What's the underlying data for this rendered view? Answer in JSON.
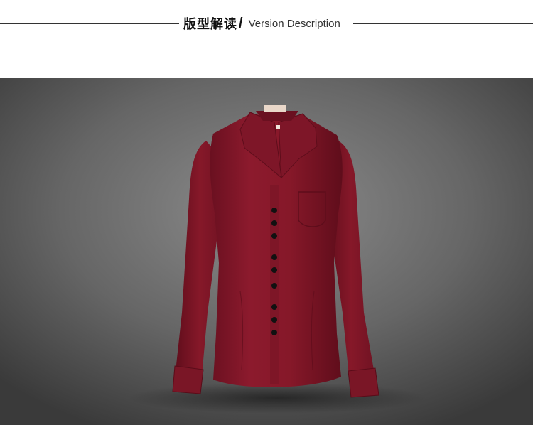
{
  "header": {
    "title_cn": "版型解读",
    "separator": "/",
    "title_en": "Version Description"
  },
  "product_image": {
    "subject": "shirt-illustration",
    "colors": {
      "background_center": "#8a8a8a",
      "background_edge": "#3e3e3e",
      "shirt": "#86182a",
      "shirt_dark": "#5e0d1b",
      "buttons": "#111111"
    }
  }
}
